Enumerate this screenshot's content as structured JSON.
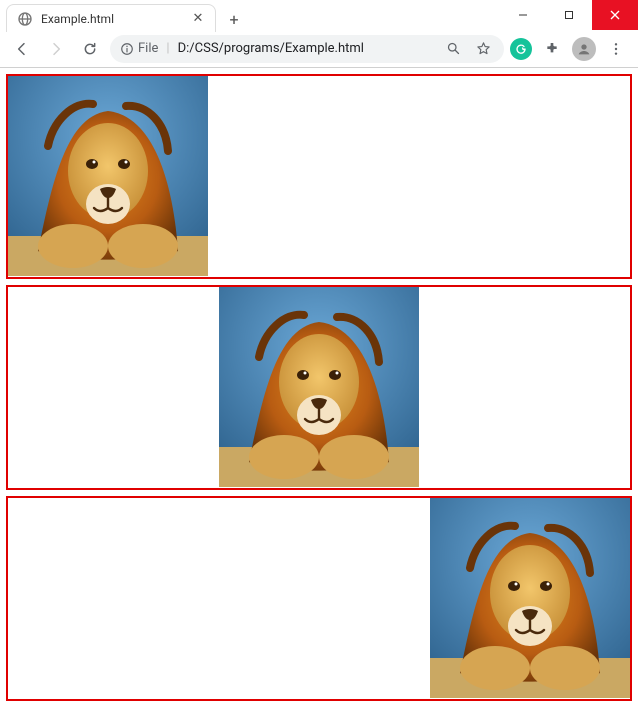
{
  "window": {
    "tab_title": "Example.html",
    "minimize_label": "–",
    "maximize_label": "□",
    "close_label": "✕"
  },
  "toolbar": {
    "file_label": "File",
    "url": "D:/CSS/programs/Example.html"
  },
  "content": {
    "boxes": [
      {
        "align": "left"
      },
      {
        "align": "center"
      },
      {
        "align": "right"
      }
    ]
  }
}
